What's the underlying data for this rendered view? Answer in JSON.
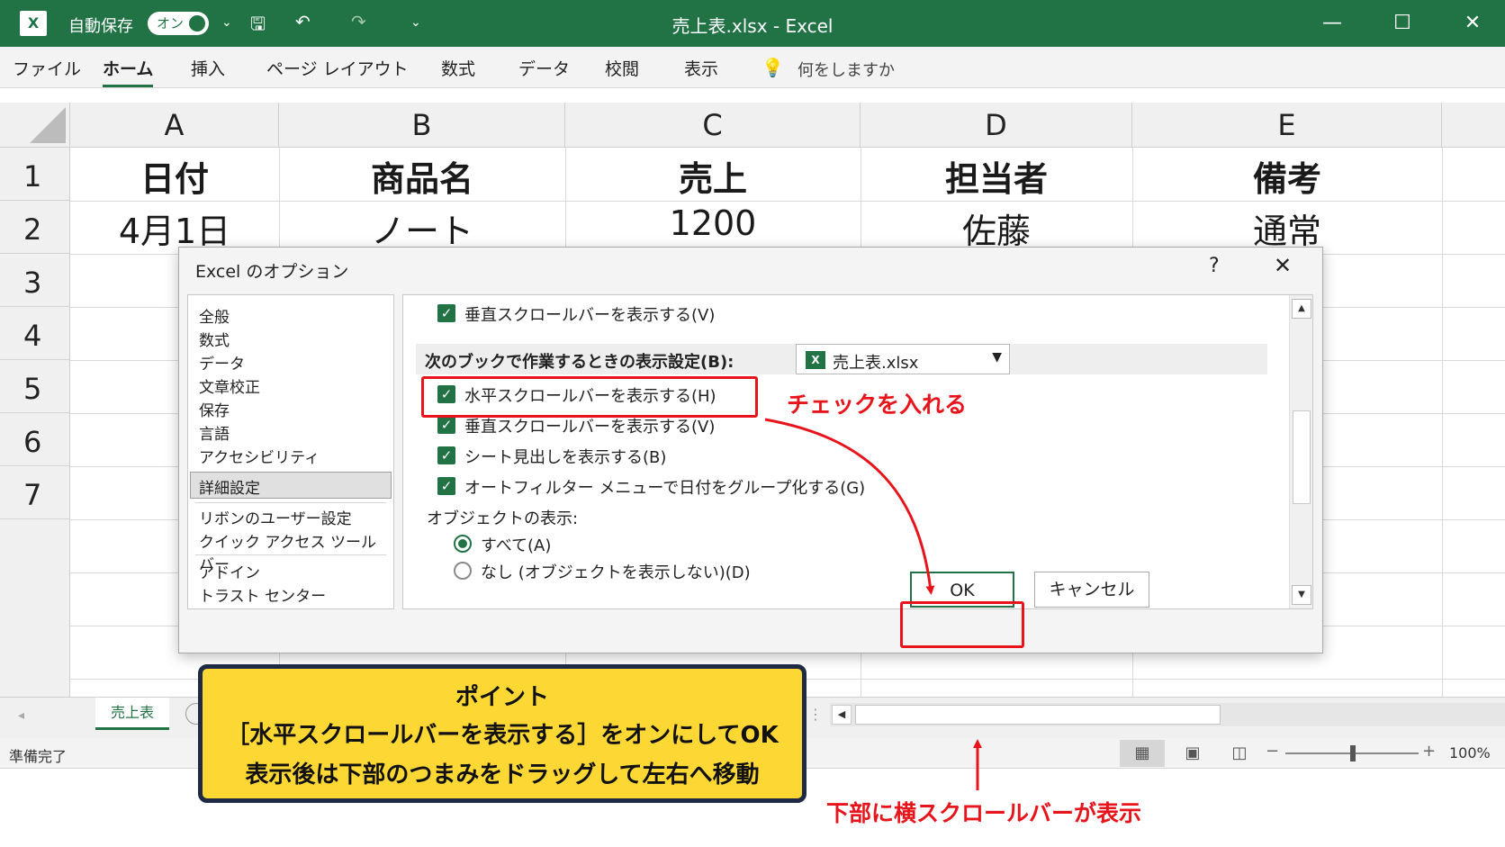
{
  "titlebar": {
    "logo": "X",
    "autosave_label": "自動保存",
    "toggle_label": "オン",
    "title": "売上表.xlsx  -  Excel"
  },
  "ribbon": {
    "tabs": [
      "ファイル",
      "ホーム",
      "挿入",
      "ページ レイアウト",
      "数式",
      "データ",
      "校閲",
      "表示"
    ],
    "active_tab": "ホーム",
    "tell_me": "何をしますか"
  },
  "sheet": {
    "columns": [
      "A",
      "B",
      "C",
      "D",
      "E"
    ],
    "rows": [
      "1",
      "2",
      "3",
      "4",
      "5",
      "6",
      "7"
    ],
    "row1": [
      "日付",
      "商品名",
      "売上",
      "担当者",
      "備考"
    ],
    "row2": [
      "4月1日",
      "ノート",
      "1200",
      "佐藤",
      "通常"
    ]
  },
  "dialog": {
    "title": "Excel のオプション",
    "help": "?",
    "close": "✕",
    "nav_items": [
      "全般",
      "数式",
      "データ",
      "文章校正",
      "保存",
      "言語",
      "アクセシビリティ",
      "詳細設定",
      "リボンのユーザー設定",
      "クイック アクセス ツール バー",
      "アドイン",
      "トラスト センター"
    ],
    "selected_nav": "詳細設定",
    "top_option": "垂直スクロールバーを表示する(V)",
    "book_section_label": "次のブックで作業するときの表示設定(B):",
    "book_value": "売上表.xlsx",
    "options": [
      "水平スクロールバーを表示する(H)",
      "垂直スクロールバーを表示する(V)",
      "シート見出しを表示する(B)",
      "オートフィルター メニューで日付をグループ化する(G)"
    ],
    "objects_label": "オブジェクトの表示:",
    "objects_options": [
      "すべて(A)",
      "なし (オブジェクトを表示しない)(D)"
    ],
    "ok": "OK",
    "cancel": "キャンセル"
  },
  "sheet_tabs": {
    "active": "売上表"
  },
  "statusbar": {
    "ready": "準備完了",
    "zoom": "100%"
  },
  "annotations": {
    "check_note": "チェックを入れる",
    "point_title": "ポイント",
    "point_line1": "［水平スクロールバーを表示する］をオンにしてOK",
    "point_line2": "表示後は下部のつまみをドラッグして左右へ移動",
    "bottom_note": "下部に横スクロールバーが表示"
  },
  "colors": {
    "excel_green": "#217346",
    "annotation_red": "#e8141b",
    "point_yellow": "#fdd835"
  }
}
